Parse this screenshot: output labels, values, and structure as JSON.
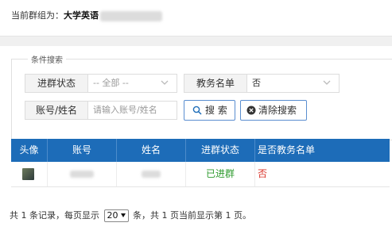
{
  "header": {
    "group_label": "当前群组为：",
    "group_name": "大学英语"
  },
  "search": {
    "legend": "条件搜索",
    "status_label": "进群状态",
    "status_value": "-- 全部 --",
    "teacher_label": "教务名单",
    "teacher_value": "否",
    "account_label": "账号/姓名",
    "account_placeholder": "请输入账号/姓名",
    "search_button": "搜 索",
    "clear_button": "清除搜索"
  },
  "table": {
    "columns": [
      "头像",
      "账号",
      "姓名",
      "进群状态",
      "是否教务名单"
    ],
    "rows": [
      {
        "status": "已进群",
        "is_teacher_list": "否"
      }
    ]
  },
  "pagination": {
    "prefix": "共 1 条记录，每页显示",
    "page_size": "20",
    "suffix": "条，共 1 页当前显示第 1 页。"
  },
  "colors": {
    "header_bg": "#1d6cb8",
    "joined": "#2e9b2e",
    "no": "#d9342b",
    "button_border": "#5a8ed0"
  }
}
